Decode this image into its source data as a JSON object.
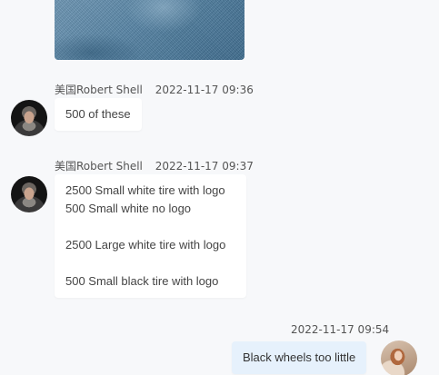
{
  "messages": [
    {
      "sender": "美国Robert Shell",
      "time": "2022-11-17 09:36",
      "lines": [
        "500 of these"
      ]
    },
    {
      "sender": "美国Robert Shell",
      "time": "2022-11-17 09:37",
      "lines": [
        "2500 Small white tire with logo",
        "500 Small white no logo",
        "",
        "2500 Large white tire with logo",
        "",
        "500 Small black tire with logo"
      ]
    },
    {
      "sender": "",
      "time": "2022-11-17 09:54",
      "lines": [
        "Black wheels too little"
      ]
    }
  ],
  "icons": {
    "incoming_avatar": "avatar-man-icon",
    "outgoing_avatar": "avatar-woman-icon"
  },
  "colors": {
    "background": "#f7f8fa",
    "incoming_bubble": "#ffffff",
    "outgoing_bubble": "#e6f1fc"
  }
}
